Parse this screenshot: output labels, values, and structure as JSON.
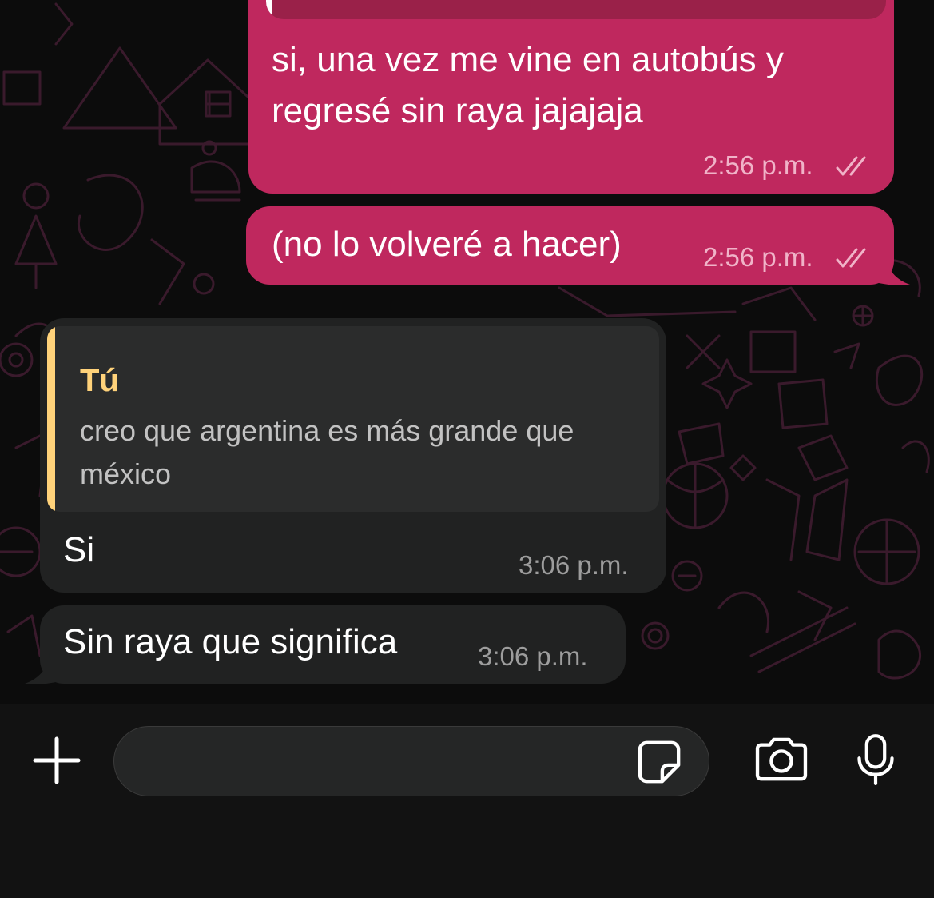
{
  "messages": [
    {
      "direction": "outgoing",
      "lines": [
        "si, una vez me vine en autobús y",
        "regresé sin raya jajajaja"
      ],
      "time": "2:56 p.m."
    },
    {
      "direction": "outgoing",
      "text": "(no lo volveré a hacer)",
      "time": "2:56 p.m."
    },
    {
      "direction": "incoming",
      "quote": {
        "author": "Tú",
        "lines": [
          "creo que argentina es más grande que",
          "méxico"
        ]
      },
      "text": "Si",
      "time": "3:06 p.m."
    },
    {
      "direction": "incoming",
      "text": "Sin raya que significa",
      "time": "3:06 p.m."
    }
  ],
  "composer": {
    "placeholder": "",
    "icons": {
      "add": "plus-icon",
      "sticker": "sticker-icon",
      "camera": "camera-icon",
      "mic": "microphone-icon"
    }
  },
  "colors": {
    "outgoing_bubble": "#bf285e",
    "incoming_bubble": "#212222",
    "quote_accent": "#ffd27a",
    "background": "#0c0c0c"
  }
}
